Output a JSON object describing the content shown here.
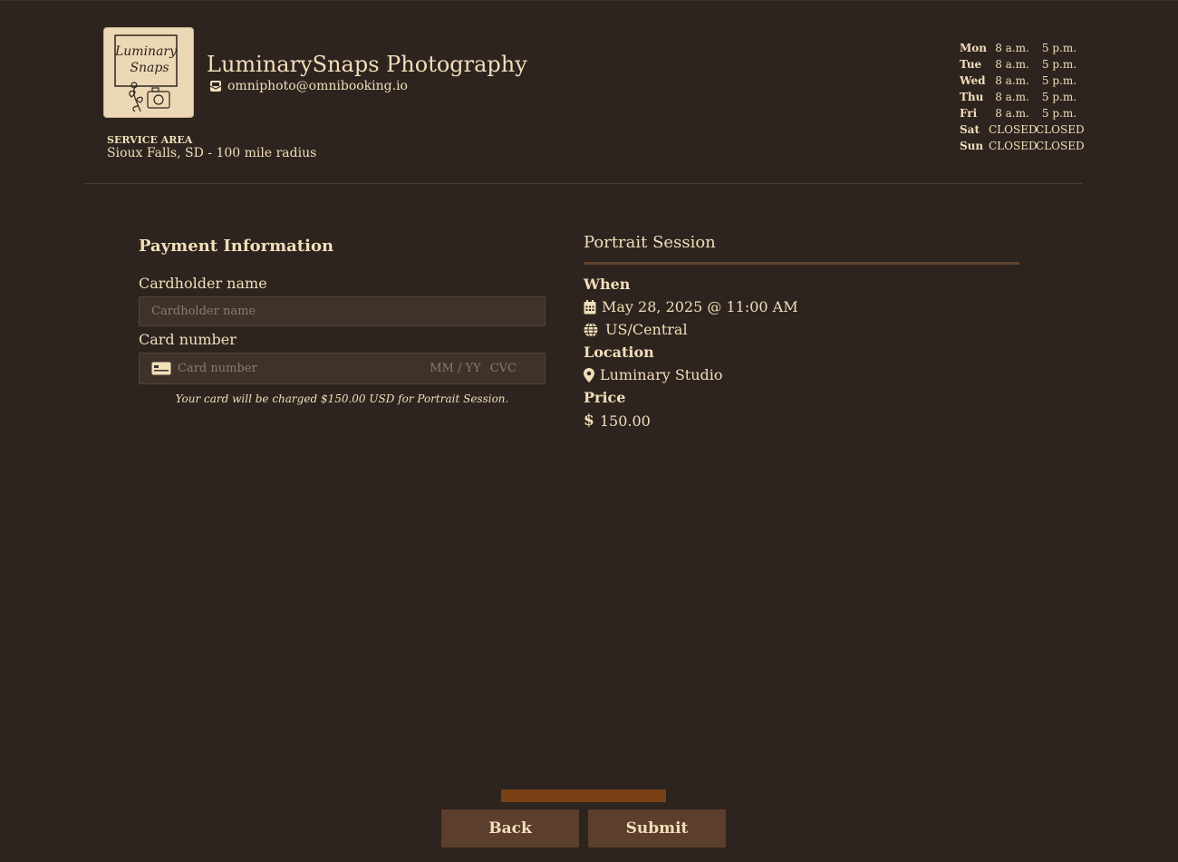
{
  "business": {
    "name": "LuminarySnaps Photography",
    "email": "omniphoto@omnibooking.io",
    "logo_text_line1": "Luminary",
    "logo_text_line2": "Snaps",
    "service_area_label": "SERVICE AREA",
    "service_area": "Sioux Falls, SD - 100 mile radius",
    "icons": {
      "email": "envelope-icon",
      "logo": "camera-flower-logo"
    }
  },
  "hours": [
    {
      "day": "Mon",
      "open": "8 a.m.",
      "close": "5 p.m."
    },
    {
      "day": "Tue",
      "open": "8 a.m.",
      "close": "5 p.m."
    },
    {
      "day": "Wed",
      "open": "8 a.m.",
      "close": "5 p.m."
    },
    {
      "day": "Thu",
      "open": "8 a.m.",
      "close": "5 p.m."
    },
    {
      "day": "Fri",
      "open": "8 a.m.",
      "close": "5 p.m."
    },
    {
      "day": "Sat",
      "open": "CLOSED",
      "close": "CLOSED"
    },
    {
      "day": "Sun",
      "open": "CLOSED",
      "close": "CLOSED"
    }
  ],
  "payment": {
    "title": "Payment Information",
    "cardholder_label": "Cardholder name",
    "cardholder_placeholder": "Cardholder name",
    "cardholder_value": "",
    "card_number_label": "Card number",
    "card_number_placeholder": "Card number",
    "expiry_placeholder": "MM / YY",
    "cvc_placeholder": "CVC",
    "charge_note": "Your card will be charged $150.00 USD for Portrait Session."
  },
  "summary": {
    "service": "Portrait Session",
    "when_label": "When",
    "date_time": "May 28, 2025 @ 11:00 AM",
    "timezone": "US/Central",
    "location_label": "Location",
    "location": "Luminary Studio",
    "price_label": "Price",
    "price": "150.00",
    "icons": {
      "date": "calendar-icon",
      "timezone": "globe-icon",
      "location": "map-pin-icon",
      "price": "dollar-icon"
    }
  },
  "progress": {
    "fraction": 1.0
  },
  "buttons": {
    "back": "Back",
    "submit": "Submit"
  },
  "colors": {
    "background": "#2e241f",
    "text": "#f1dfba",
    "input_bg": "#3f322b",
    "button_bg": "#5b3e2c",
    "accent": "#7a4016"
  }
}
